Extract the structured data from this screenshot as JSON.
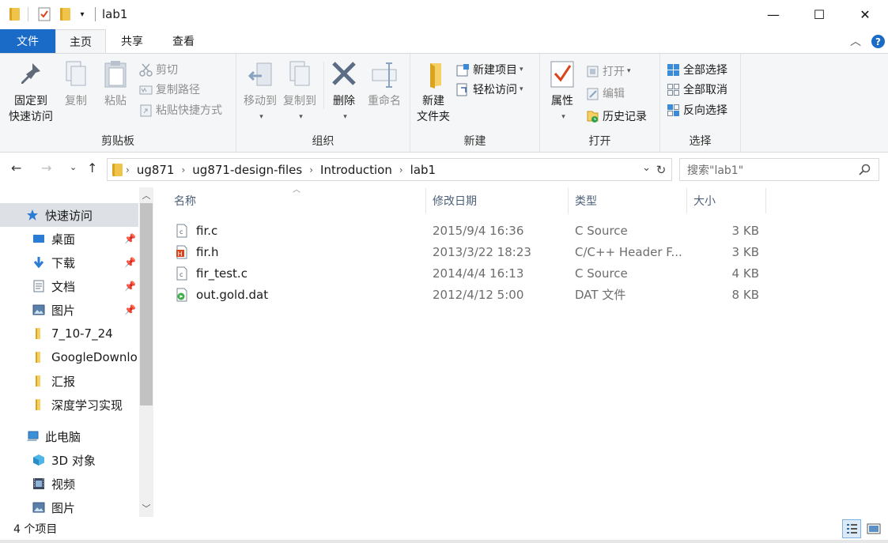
{
  "window": {
    "title": "lab1",
    "minimize": "—",
    "maximize": "☐",
    "close": "✕"
  },
  "tabs": {
    "file": "文件",
    "home": "主页",
    "share": "共享",
    "view": "查看"
  },
  "ribbon": {
    "clipboard": {
      "label": "剪贴板",
      "pin_line1": "固定到",
      "pin_line2": "快速访问",
      "copy": "复制",
      "paste": "粘贴",
      "cut": "剪切",
      "copy_path": "复制路径",
      "paste_shortcut": "粘贴快捷方式"
    },
    "organize": {
      "label": "组织",
      "move_to": "移动到",
      "copy_to": "复制到",
      "delete": "删除",
      "rename": "重命名"
    },
    "new": {
      "label": "新建",
      "new_folder_line1": "新建",
      "new_folder_line2": "文件夹",
      "new_item": "新建项目",
      "easy_access": "轻松访问"
    },
    "open": {
      "label": "打开",
      "properties": "属性",
      "open": "打开",
      "edit": "编辑",
      "history": "历史记录"
    },
    "select": {
      "label": "选择",
      "select_all": "全部选择",
      "select_none": "全部取消",
      "invert": "反向选择"
    }
  },
  "address": {
    "crumbs": [
      "ug871",
      "ug871-design-files",
      "Introduction",
      "lab1"
    ],
    "search_placeholder": "搜索\"lab1\""
  },
  "nav_pane": {
    "quick_access": "快速访问",
    "items": [
      {
        "label": "桌面",
        "icon": "desktop-icon",
        "pinned": true
      },
      {
        "label": "下载",
        "icon": "download-icon",
        "pinned": true
      },
      {
        "label": "文档",
        "icon": "document-icon",
        "pinned": true
      },
      {
        "label": "图片",
        "icon": "pictures-icon",
        "pinned": true
      },
      {
        "label": "7_10-7_24",
        "icon": "folder-icon",
        "pinned": false
      },
      {
        "label": "GoogleDownlo",
        "icon": "folder-icon",
        "pinned": false
      },
      {
        "label": "汇报",
        "icon": "folder-icon",
        "pinned": false
      },
      {
        "label": "深度学习实现",
        "icon": "folder-icon",
        "pinned": false
      }
    ],
    "this_pc": "此电脑",
    "pc_items": [
      {
        "label": "3D 对象",
        "icon": "3d-objects-icon"
      },
      {
        "label": "视频",
        "icon": "videos-icon"
      },
      {
        "label": "图片",
        "icon": "pictures-icon"
      }
    ]
  },
  "columns": {
    "name": "名称",
    "date": "修改日期",
    "type": "类型",
    "size": "大小"
  },
  "files": [
    {
      "name": "fir.c",
      "date": "2015/9/4 16:36",
      "type": "C Source",
      "size": "3 KB",
      "icon": "c-source-icon"
    },
    {
      "name": "fir.h",
      "date": "2013/3/22 18:23",
      "type": "C/C++ Header F...",
      "size": "3 KB",
      "icon": "header-file-icon"
    },
    {
      "name": "fir_test.c",
      "date": "2014/4/4 16:13",
      "type": "C Source",
      "size": "4 KB",
      "icon": "c-source-icon"
    },
    {
      "name": "out.gold.dat",
      "date": "2012/4/12 5:00",
      "type": "DAT 文件",
      "size": "8 KB",
      "icon": "dat-file-icon"
    }
  ],
  "status": {
    "item_count": "4 个项目"
  },
  "colors": {
    "accent": "#1a6ac7",
    "folder": "#f0c44a"
  }
}
